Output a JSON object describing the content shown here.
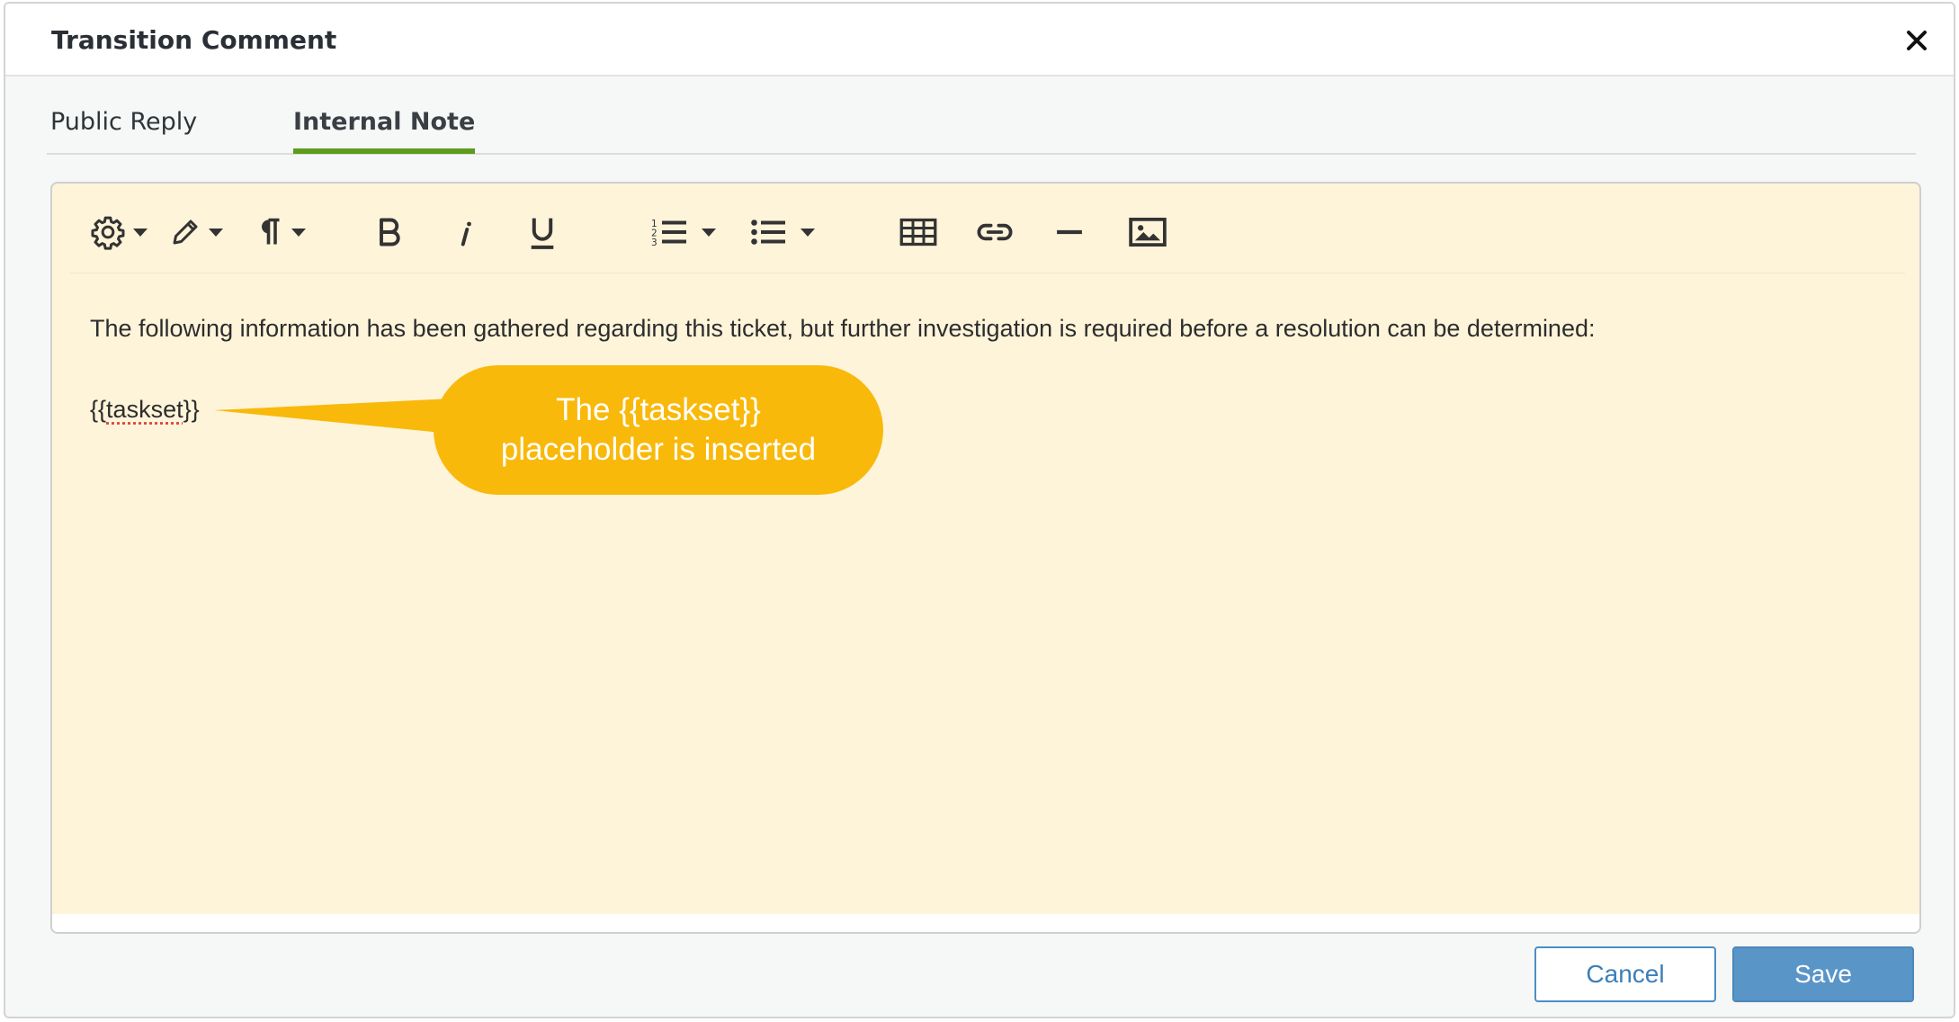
{
  "dialog": {
    "title": "Transition Comment",
    "close_icon": "close-icon"
  },
  "tabs": [
    {
      "label": "Public Reply",
      "active": false
    },
    {
      "label": "Internal Note",
      "active": true
    }
  ],
  "toolbar": {
    "items": [
      {
        "icon": "gear-icon",
        "dropdown": true
      },
      {
        "icon": "pencil-icon",
        "dropdown": true
      },
      {
        "icon": "paragraph-icon",
        "dropdown": true
      },
      {
        "icon": "bold-icon",
        "label": "B"
      },
      {
        "icon": "italic-icon",
        "label": "i"
      },
      {
        "icon": "underline-icon",
        "label": "U"
      },
      {
        "icon": "ordered-list-icon",
        "dropdown": true
      },
      {
        "icon": "bulleted-list-icon",
        "dropdown": true
      },
      {
        "icon": "table-icon"
      },
      {
        "icon": "link-icon"
      },
      {
        "icon": "horizontal-rule-icon"
      },
      {
        "icon": "image-icon"
      }
    ]
  },
  "editor": {
    "paragraph": "The following information has been gathered regarding this ticket, but further investigation is required before a resolution can be determined:",
    "placeholder_open": "{{",
    "placeholder_word": "taskset",
    "placeholder_close": "}}"
  },
  "callout": {
    "line1": "The {{taskset}}",
    "line2": "placeholder is inserted",
    "color": "#f9b90a"
  },
  "buttons": {
    "cancel": "Cancel",
    "save": "Save"
  },
  "colors": {
    "editor_bg": "#fef4da",
    "active_tab_underline": "#5c9c1e",
    "primary_button": "#5a95c8"
  }
}
